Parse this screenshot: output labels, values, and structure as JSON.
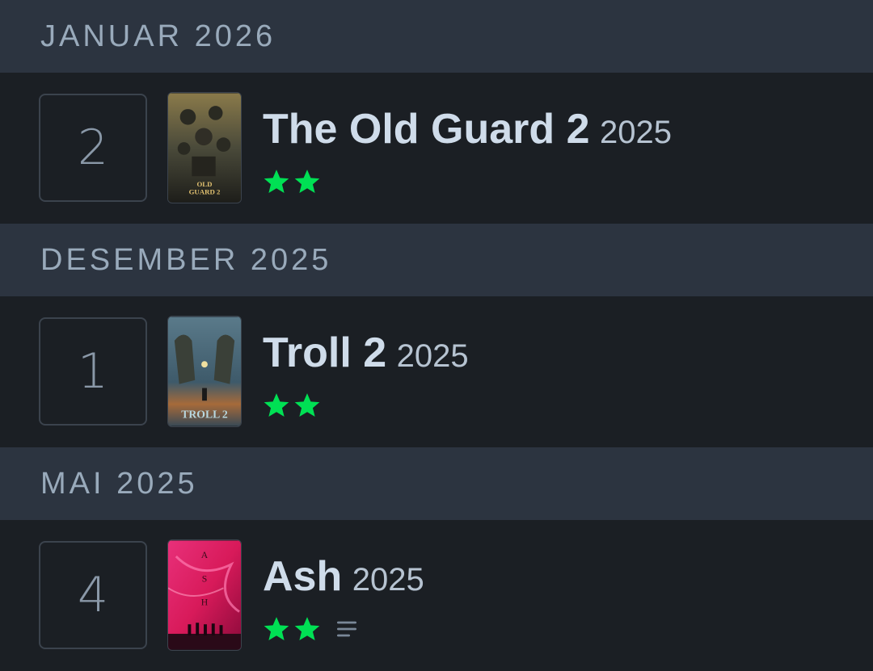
{
  "colors": {
    "header_bg": "#2c3440",
    "row_bg": "#1b1f24",
    "star_green": "#00e054",
    "title": "#cfdcea",
    "muted": "#99aabb"
  },
  "months": [
    {
      "label": "JANUAR 2026",
      "entries": [
        {
          "day": "2",
          "title": "The Old Guard 2",
          "year": "2025",
          "stars": 2,
          "has_review": false,
          "poster_icon": "the-old-guard-2-poster"
        }
      ]
    },
    {
      "label": "DESEMBER 2025",
      "entries": [
        {
          "day": "1",
          "title": "Troll 2",
          "year": "2025",
          "stars": 2,
          "has_review": false,
          "poster_icon": "troll-2-poster"
        }
      ]
    },
    {
      "label": "MAI 2025",
      "entries": [
        {
          "day": "4",
          "title": "Ash",
          "year": "2025",
          "stars": 2,
          "has_review": true,
          "poster_icon": "ash-poster"
        }
      ]
    }
  ]
}
